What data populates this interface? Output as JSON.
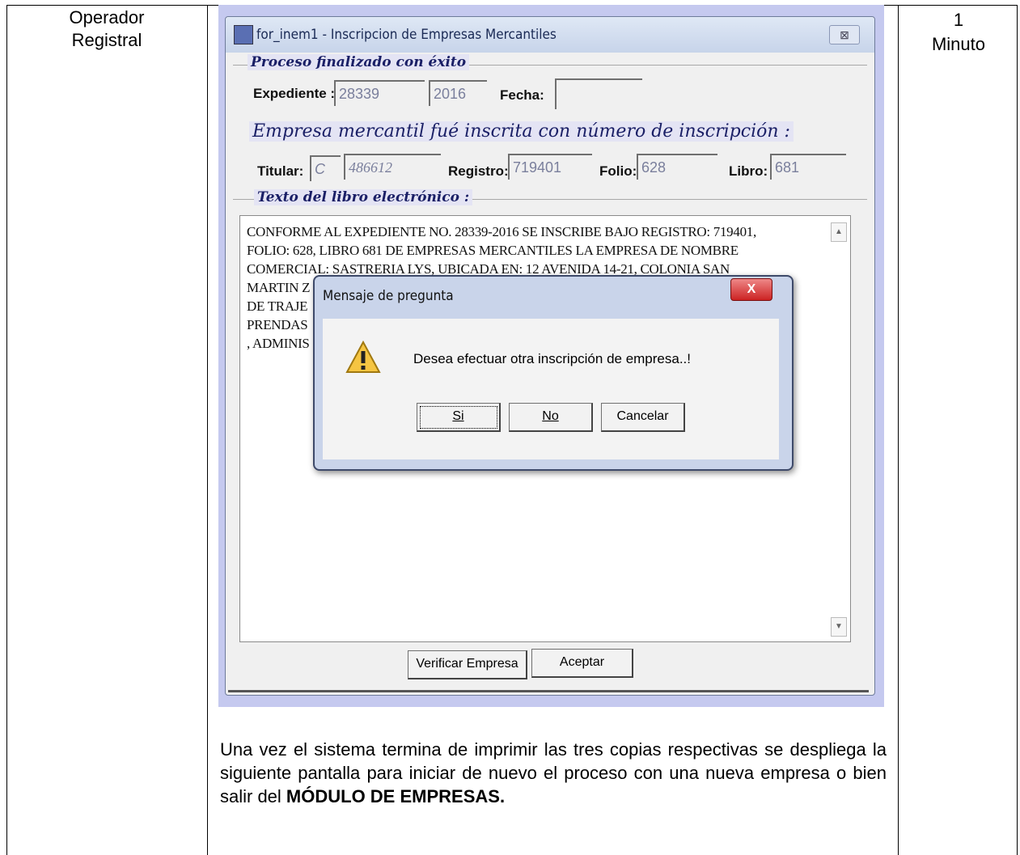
{
  "table": {
    "role": [
      "Operador",
      "Registral"
    ],
    "time": [
      "1",
      "Minuto"
    ]
  },
  "window": {
    "title": "for_inem1 - Inscripcion de Empresas Mercantiles",
    "close_label": "⊠",
    "group1_title": "Proceso finalizado con éxito",
    "expediente_label": "Expediente :",
    "expediente_value": "28339",
    "year_value": "2016",
    "fecha_label": "Fecha:",
    "fecha_value": "",
    "heading": "Empresa mercantil fué inscrita con número de inscripción :",
    "titular_label": "Titular:",
    "titular_value1": "C",
    "titular_value2": "486612",
    "registro_label": "Registro:",
    "registro_value": "719401",
    "folio_label": "Folio:",
    "folio_value": "628",
    "libro_label": "Libro:",
    "libro_value": "681",
    "group2_title": "Texto del libro electrónico :",
    "text_lines": [
      "CONFORME AL EXPEDIENTE NO. 28339-2016 SE INSCRIBE BAJO REGISTRO: 719401,",
      "FOLIO: 628, LIBRO 681 DE EMPRESAS MERCANTILES LA EMPRESA DE NOMBRE",
      "COMERCIAL: SASTRERIA LYS, UBICADA EN: 12 AVENIDA 14-21, COLONIA SAN",
      "MARTIN Z                                                                                                    IÓN",
      "DE TRAJE                                                                                                    E",
      "PRENDAS                                                                                                    MOS",
      ", ADMINIS                                                                                                   016."
    ],
    "verify_button": "Verificar Empresa",
    "accept_button": "Aceptar"
  },
  "dialog": {
    "title": "Mensaje de pregunta",
    "close_label": "X",
    "message": "Desea efectuar otra inscripción de empresa..!",
    "yes_button": "Si",
    "no_button": "No",
    "cancel_button": "Cancelar"
  },
  "paragraph": {
    "text": "Una vez el sistema termina de imprimir las tres copias respectivas se despliega la siguiente pantalla para iniciar de nuevo el proceso con una nueva empresa o bien salir del ",
    "bold": "MÓDULO DE EMPRESAS."
  }
}
